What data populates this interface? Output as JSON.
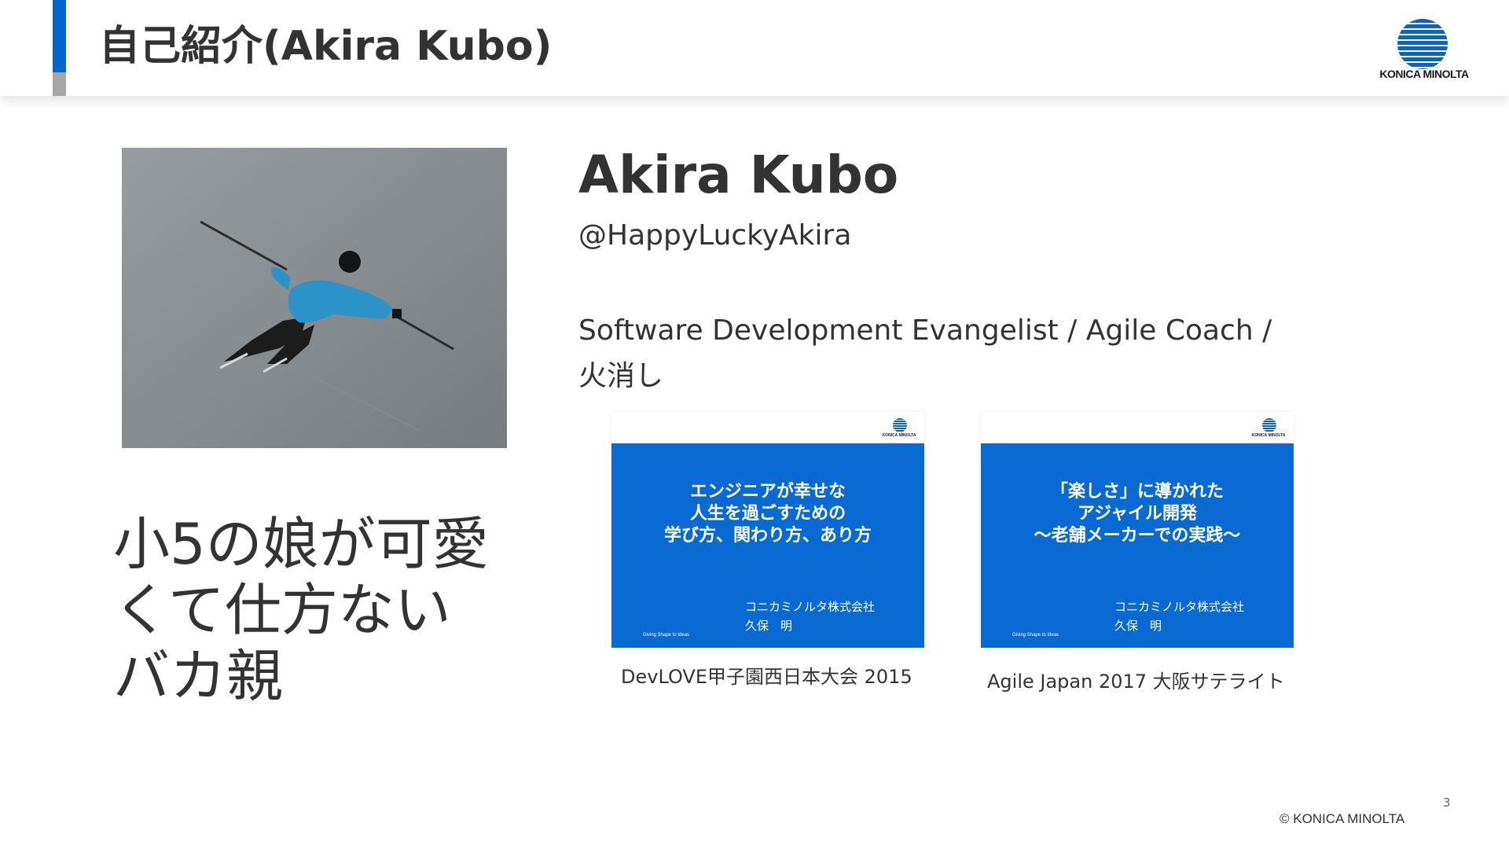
{
  "slide": {
    "title": "自己紹介(Akira Kubo)",
    "page_number": "3",
    "copyright": "© KONICA MINOLTA"
  },
  "logo": {
    "text": "KONICA MINOLTA",
    "icon": "konica-minolta-globe-icon"
  },
  "profile": {
    "name": "Akira Kubo",
    "handle": "@HappyLuckyAkira",
    "roles_line1": "Software Development Evangelist / Agile Coach /",
    "roles_line2": "火消し",
    "photo": "skier-photo"
  },
  "daughter_text": {
    "line1": "小5の娘が可愛",
    "line2": "くて仕方ない",
    "line3": "バカ親"
  },
  "talks": [
    {
      "title_lines": [
        "エンジニアが幸せな",
        "人生を過ごすための",
        "学び方、関わり方、あり方"
      ],
      "company": "コニカミノルタ株式会社",
      "author": "久保　明",
      "tagline": "Giving Shape to Ideas",
      "logo_text": "KONICA MINOLTA",
      "caption": "DevLOVE甲子園西日本大会 2015"
    },
    {
      "title_lines": [
        "「楽しさ」に導かれた",
        "アジャイル開発",
        "～老舗メーカーでの実践～"
      ],
      "company": "コニカミノルタ株式会社",
      "author": "久保　明",
      "tagline": "Giving Shape to Ideas",
      "logo_text": "KONICA MINOLTA",
      "caption": "Agile Japan 2017 大阪サテライト"
    }
  ],
  "colors": {
    "accent_blue": "#0066cc",
    "accent_gray": "#a6a6a6",
    "thumb_blue": "#0a6ad3",
    "text": "#333333"
  }
}
